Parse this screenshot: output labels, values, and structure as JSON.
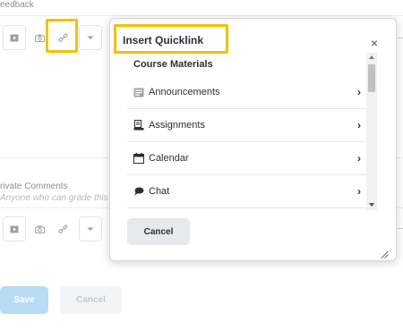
{
  "background": {
    "feedback_label": "eedback",
    "private_comments_label": "rivate Comments",
    "private_comments_sub": "Anyone who can grade this a",
    "save_label": "Save",
    "cancel_label": "Cancel",
    "toolbar_icons": [
      "video-icon",
      "camera-icon",
      "link-icon",
      "dropdown-icon"
    ]
  },
  "dialog": {
    "title": "Insert Quicklink",
    "category_heading": "Course Materials",
    "items": [
      {
        "label": "Announcements",
        "icon": "announcements-icon"
      },
      {
        "label": "Assignments",
        "icon": "assignments-icon"
      },
      {
        "label": "Calendar",
        "icon": "calendar-icon"
      },
      {
        "label": "Chat",
        "icon": "chat-icon"
      }
    ],
    "cancel_label": "Cancel",
    "close_glyph": "×",
    "chevron_glyph": "›"
  },
  "colors": {
    "highlight": "#f3c000",
    "save_button": "#b8dcf5"
  }
}
